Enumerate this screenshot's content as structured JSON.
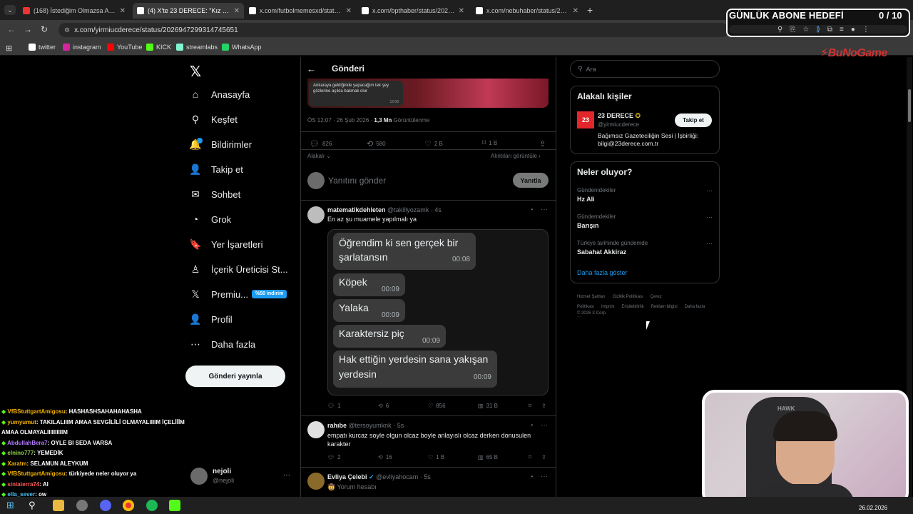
{
  "browser": {
    "tabs": [
      {
        "title": "(168) İstediğim Olmazsa Aldatı",
        "icon_color": "#e33"
      },
      {
        "title": "(4) X'te 23 DERECE: \"Kız arkadaş",
        "icon_color": "#fff"
      },
      {
        "title": "x.com/futbolmemesxd/status/2",
        "icon_color": "#fff"
      },
      {
        "title": "x.com/bpthaber/status/202702",
        "icon_color": "#fff"
      },
      {
        "title": "x.com/nebuhaber/status/20266",
        "icon_color": "#fff"
      }
    ],
    "url": "x.com/yirmiucderece/status/2026947299314745651",
    "bookmarks": [
      {
        "label": "twitter",
        "icon_color": "#fff"
      },
      {
        "label": "instagram",
        "icon_color": "#d6249f"
      },
      {
        "label": "YouTube",
        "icon_color": "#f00"
      },
      {
        "label": "KICK",
        "icon_color": "#53fc18"
      },
      {
        "label": "streamlabs",
        "icon_color": "#80f5d2"
      },
      {
        "label": "WhatsApp",
        "icon_color": "#25d366"
      }
    ]
  },
  "overlay": {
    "goal_title": "GÜNLÜK ABONE HEDEFİ",
    "goal_count": "0",
    "goal_total": "/ 10",
    "goal_progress": 0,
    "brand": "BuNoGame"
  },
  "nav": {
    "items": [
      {
        "label": "Anasayfa",
        "icon": "home-icon",
        "glyph": "⌂"
      },
      {
        "label": "Keşfet",
        "icon": "search-icon",
        "glyph": "⚲"
      },
      {
        "label": "Bildirimler",
        "icon": "bell-icon",
        "glyph": "🔔"
      },
      {
        "label": "Takip et",
        "icon": "person-add-icon",
        "glyph": "👤"
      },
      {
        "label": "Sohbet",
        "icon": "mail-icon",
        "glyph": "✉"
      },
      {
        "label": "Grok",
        "icon": "grok-icon",
        "glyph": "◔"
      },
      {
        "label": "Yer İşaretleri",
        "icon": "bookmark-icon",
        "glyph": "🔖"
      },
      {
        "label": "İçerik Üreticisi St...",
        "icon": "creator-icon",
        "glyph": "♙"
      },
      {
        "label": "Premiu...",
        "icon": "x-premium-icon",
        "glyph": "𝕏"
      },
      {
        "label": "Profil",
        "icon": "profile-icon",
        "glyph": "👤"
      },
      {
        "label": "Daha fazla",
        "icon": "more-icon",
        "glyph": "⋯"
      }
    ],
    "premium_badge": "%50 indirim",
    "post_button": "Gönderi yayınla",
    "account_name": "nejoli",
    "account_handle": "@nejoli"
  },
  "header": {
    "title": "Gönderi"
  },
  "main_post": {
    "image_caption": "Ankaraya geldiğinde yapacağım tek şey gözlerine aşıkla bakmak olur",
    "image_time": "12:08",
    "meta_time": "ÖS 12:07 · 26 Şub 2026 · ",
    "meta_views": "1,3 Mn",
    "meta_views_label": " Görüntülenme",
    "stats": {
      "replies": "826",
      "reposts": "580",
      "likes": "2 B",
      "bookmarks": "1 B"
    },
    "relevance": "Alakalı",
    "quotes_link": "Alıntıları görüntüle"
  },
  "reply_box": {
    "placeholder": "Yanıtını gönder",
    "button": "Yanıtla"
  },
  "replies": [
    {
      "name": "matematikdehleten",
      "handle": "@takillyozamk",
      "time": "· 4s",
      "text": "En az şu muamele yapılmalı ya",
      "bubbles": [
        {
          "text": "Öğrendim ki sen gerçek bir şarlatansın",
          "time": "00:08"
        },
        {
          "text": "Köpek",
          "time": "00:09"
        },
        {
          "text": "Yalaka",
          "time": "00:09"
        },
        {
          "text": "Karaktersiz piç",
          "time": "00:09"
        },
        {
          "text": "Hak ettiğin yerdesin sana yakışan yerdesin",
          "time": "00:09"
        }
      ],
      "stats": {
        "replies": "1",
        "reposts": "6",
        "likes": "856",
        "views": "31 B"
      }
    },
    {
      "name": "rahıbe",
      "handle": "@tersoyumknk",
      "time": "· 5s",
      "text": "empatı kurcaz soyle olgun olcaz boyle anlayıslı olcaz derken donusulen karakter",
      "stats": {
        "replies": "2",
        "reposts": "16",
        "likes": "1 B",
        "views": "65 B"
      }
    },
    {
      "name": "Evliya Çelebi",
      "handle": "@evliyahocam",
      "time": "· 5s",
      "text": "🤠 Yorum hesabı"
    }
  ],
  "sidebar": {
    "search_placeholder": "Ara",
    "related_title": "Alakalı kişiler",
    "related_name": "23 DERECE",
    "related_handle": "@yirmiucderece",
    "related_bio": "Bağımsız Gazeteciliğin Sesi | İşbirliği: bilgi@23derece.com.tr",
    "follow_button": "Takip et",
    "trends_title": "Neler oluyor?",
    "trends": [
      {
        "meta": "Gündemdekiler",
        "name": "Hz Ali"
      },
      {
        "meta": "Gündemdekiler",
        "name": "Barışın"
      },
      {
        "meta": "Türkiye tarihinde gündemde",
        "name": "Sabahat Akkiraz"
      }
    ],
    "show_more": "Daha fazla göster",
    "footer_links": [
      "Hizmet Şartları",
      "Gizlilik Politikası",
      "Çerez Politikası",
      "Imprint",
      "Erişilebilirlik",
      "Reklam bilgisi",
      "Daha fazla ···"
    ],
    "copyright": "© 2026 X Corp."
  },
  "chat": [
    {
      "user": "VfBStuttgartAmigosu",
      "msg": ": HASHASHSAHAHAHASHA",
      "color": "#f5b400"
    },
    {
      "user": "yumyumut",
      "msg": ": TAKILALIIIM AMAA SEVGİLİLİ OLMAYALIIIIM İÇELİİİM",
      "color": "#f5b400"
    },
    {
      "user": "",
      "msg": "AMAA OLMAYALIIIIIIIIIIM",
      "color": "#fff"
    },
    {
      "user": "AbdullahBera7",
      "msg": ": OYLE BI SEDA VARSA",
      "color": "#b57cff"
    },
    {
      "user": "elnino777",
      "msg": ": YEMEDİK",
      "color": "#8fd14f"
    },
    {
      "user": "Xaratm",
      "msg": ": SELAMUN ALEYKUM",
      "color": "#f5b400"
    },
    {
      "user": "VfBStuttgartAmigosu",
      "msg": ": türkiyede neler oluyor ya",
      "color": "#f5b400"
    },
    {
      "user": "siniaterra74",
      "msg": ": Al",
      "color": "#ff5a5a"
    },
    {
      "user": "ella_sever",
      "msg": ": ow",
      "color": "#4fc3f7"
    }
  ],
  "webcam": {
    "chair_brand": "HAWK"
  },
  "taskbar": {
    "date": "26.02.2026"
  }
}
